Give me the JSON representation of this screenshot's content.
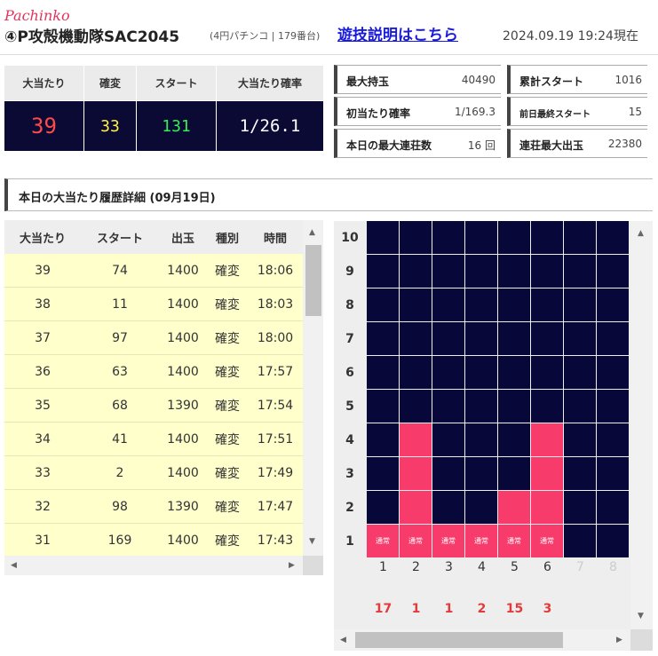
{
  "header": {
    "brand": "Pachinko",
    "machine": "④P攻殻機動隊SAC2045",
    "subtitle": "(4円パチンコ | 179番台)",
    "guide_link": "遊技説明はこちら",
    "timestamp": "2024.09.19 19:24現在"
  },
  "big_stats": [
    {
      "label": "大当たり",
      "value": "39",
      "color": "#ff4a4a"
    },
    {
      "label": "確変",
      "value": "33",
      "color": "#ffee44"
    },
    {
      "label": "スタート",
      "value": "131",
      "color": "#33ee55"
    },
    {
      "label": "大当たり確率",
      "value": "1/26.1",
      "color": "#ffffff"
    }
  ],
  "mini_stats": [
    {
      "label": "最大持玉",
      "value": "40490"
    },
    {
      "label": "累計スタート",
      "value": "1016"
    },
    {
      "label": "初当たり確率",
      "value": "1/169.3"
    },
    {
      "label": "前日最終スタート",
      "value": "15"
    },
    {
      "label": "本日の最大連荘数",
      "value": "16 回"
    },
    {
      "label": "連荘最大出玉",
      "value": "22380"
    }
  ],
  "history": {
    "title": "本日の大当たり履歴詳細 (09月19日)",
    "columns": [
      "大当たり",
      "スタート",
      "出玉",
      "種別",
      "時間"
    ],
    "rows": [
      [
        "39",
        "74",
        "1400",
        "確変",
        "18:06"
      ],
      [
        "38",
        "11",
        "1400",
        "確変",
        "18:03"
      ],
      [
        "37",
        "97",
        "1400",
        "確変",
        "18:00"
      ],
      [
        "36",
        "63",
        "1400",
        "確変",
        "17:57"
      ],
      [
        "35",
        "68",
        "1390",
        "確変",
        "17:54"
      ],
      [
        "34",
        "41",
        "1400",
        "確変",
        "17:51"
      ],
      [
        "33",
        "2",
        "1400",
        "確変",
        "17:49"
      ],
      [
        "32",
        "98",
        "1390",
        "確変",
        "17:47"
      ],
      [
        "31",
        "169",
        "1400",
        "確変",
        "17:43"
      ]
    ]
  },
  "chain_chart": {
    "y_labels": [
      "10",
      "9",
      "8",
      "7",
      "6",
      "5",
      "4",
      "3",
      "2",
      "1"
    ],
    "x_labels": [
      "1",
      "2",
      "3",
      "4",
      "5",
      "6",
      "7",
      "8"
    ],
    "bottom_tag": "通常",
    "columns": [
      {
        "height": 1,
        "count": "17"
      },
      {
        "height": 4,
        "count": "1"
      },
      {
        "height": 1,
        "count": "1"
      },
      {
        "height": 1,
        "count": "2"
      },
      {
        "height": 2,
        "count": "15"
      },
      {
        "height": 4,
        "count": "3"
      },
      {
        "height": 0,
        "count": ""
      },
      {
        "height": 0,
        "count": ""
      }
    ]
  },
  "icons": {
    "up": "▲",
    "down": "▼",
    "left": "◀",
    "right": "▶"
  }
}
